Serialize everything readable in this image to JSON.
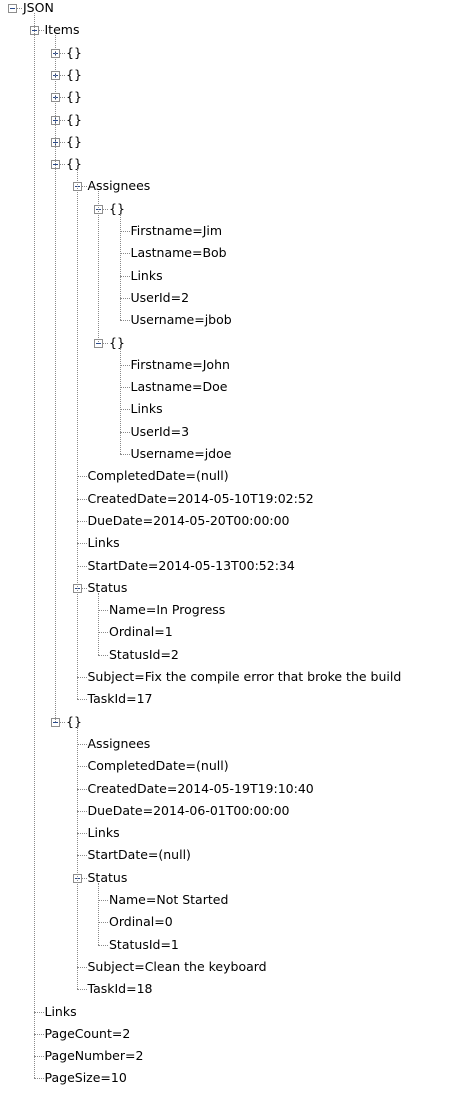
{
  "tree": {
    "root": "JSON",
    "items_label": "Items",
    "collapsed_objects": [
      "{}",
      "{}",
      "{}",
      "{}",
      "{}"
    ],
    "item6": {
      "label": "{}",
      "assignees": {
        "label": "Assignees",
        "objects": [
          {
            "label": "{}",
            "fields": [
              "Firstname=Jim",
              "Lastname=Bob",
              "Links",
              "UserId=2",
              "Username=jbob"
            ]
          },
          {
            "label": "{}",
            "fields": [
              "Firstname=John",
              "Lastname=Doe",
              "Links",
              "UserId=3",
              "Username=jdoe"
            ]
          }
        ]
      },
      "fields_before_status": [
        "CompletedDate=(null)",
        "CreatedDate=2014-05-10T19:02:52",
        "DueDate=2014-05-20T00:00:00",
        "Links",
        "StartDate=2014-05-13T00:52:34"
      ],
      "status": {
        "label": "Status",
        "fields": [
          "Name=In Progress",
          "Ordinal=1",
          "StatusId=2"
        ]
      },
      "fields_after_status": [
        "Subject=Fix the compile error that broke the build",
        "TaskId=17"
      ]
    },
    "item7": {
      "label": "{}",
      "fields_before_status": [
        "Assignees",
        "CompletedDate=(null)",
        "CreatedDate=2014-05-19T19:10:40",
        "DueDate=2014-06-01T00:00:00",
        "Links",
        "StartDate=(null)"
      ],
      "status": {
        "label": "Status",
        "fields": [
          "Name=Not Started",
          "Ordinal=0",
          "StatusId=1"
        ]
      },
      "fields_after_status": [
        "Subject=Clean the keyboard",
        "TaskId=18"
      ]
    },
    "root_fields": [
      "Links",
      "PageCount=2",
      "PageNumber=2",
      "PageSize=10"
    ]
  }
}
